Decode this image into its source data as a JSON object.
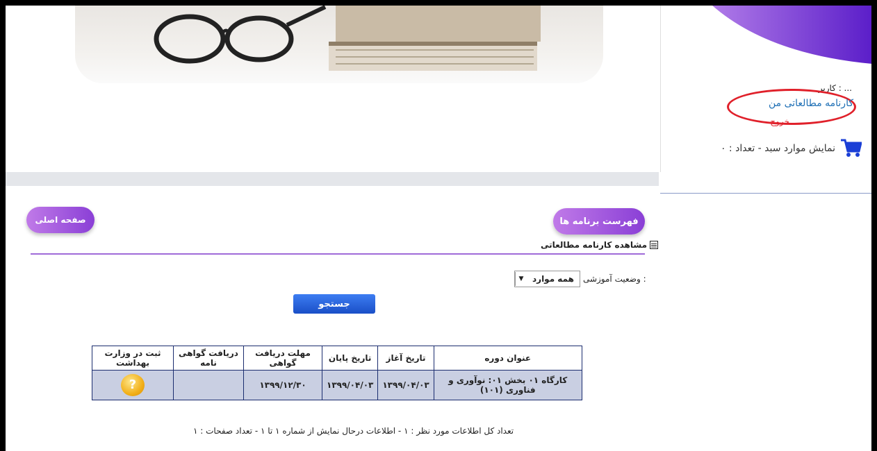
{
  "user_panel": {
    "user_name": "کاربر : ...",
    "study_report_link": "کارنامه مطالعاتی من",
    "logout_label": "خروج",
    "cart_text": "نمایش موارد سبد - تعداد : ۰"
  },
  "buttons": {
    "programs_list": "فهرست برنامه ها",
    "home_page": "صفحه اصلی",
    "search": "جستجو"
  },
  "section": {
    "title": "مشاهده کارنامه مطالعاتی"
  },
  "filter": {
    "status_label": "وضعیت آموزشی :",
    "status_value": "همه موارد"
  },
  "table": {
    "headers": [
      "عنوان دوره",
      "تاریخ آغاز",
      "تاریخ پایان",
      "مهلت دریافت گواهی",
      "دریافت گواهی نامه",
      "ثبت در وزارت بهداشت"
    ],
    "rows": [
      {
        "course_title": "کارگاه ۰۱ بخش ۰۱: نوآوری و فناوری (۱۰۱)",
        "start_date": "۱۳۹۹/۰۴/۰۳",
        "end_date": "۱۳۹۹/۰۴/۰۳",
        "certificate_deadline": "۱۳۹۹/۱۲/۳۰",
        "certificate_receive": "",
        "ministry_registration_icon": "question-icon"
      }
    ]
  },
  "footer": {
    "summary": "تعداد کل اطلاعات مورد نظر : ۱ - اطلاعات درحال نمایش از شماره ۱ تا ۱ - تعداد صفحات : ۱"
  },
  "colors": {
    "accent_purple": "#8a3fd6",
    "link_blue": "#1e6fb5",
    "table_border": "#1a2c6e",
    "row_bg": "#c9cfe2"
  }
}
